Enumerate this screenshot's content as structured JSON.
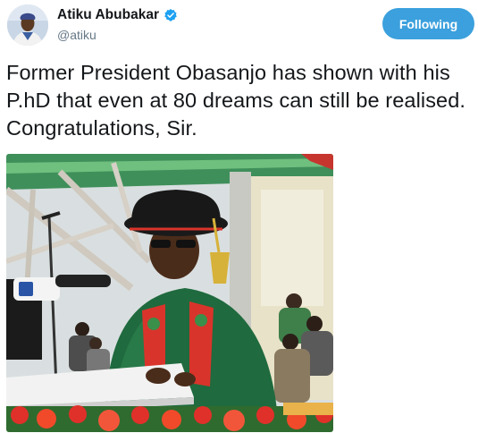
{
  "author": {
    "display_name": "Atiku Abubakar",
    "handle": "@atiku",
    "verified": true,
    "avatar_icon": "profile-photo-icon",
    "verified_icon": "verified-badge-icon"
  },
  "follow_button": {
    "label": "Following",
    "color": "#3ba0dd"
  },
  "tweet": {
    "text": "Former President Obasanjo has shown with his P.hD that even at 80 dreams can still be realised. Congratulations, Sir."
  },
  "media": {
    "type": "photo"
  }
}
